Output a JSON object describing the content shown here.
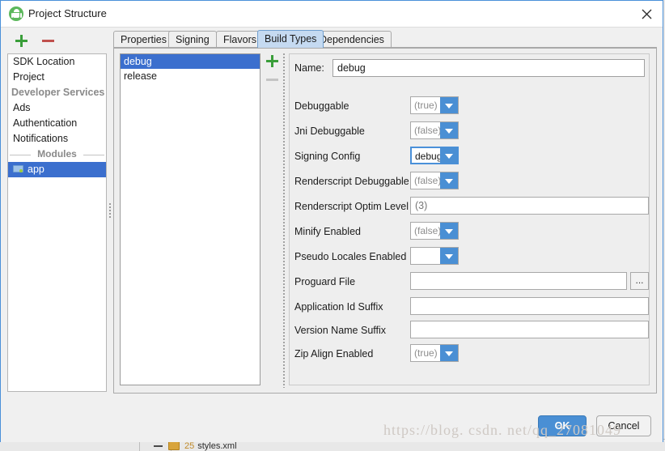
{
  "window": {
    "title": "Project Structure",
    "icon": "android-studio-icon",
    "close_label": "✕"
  },
  "sidebar": {
    "add_label": "+",
    "remove_label": "−",
    "items": [
      {
        "label": "SDK Location",
        "type": "item",
        "selected": false
      },
      {
        "label": "Project",
        "type": "item",
        "selected": false
      },
      {
        "label": "Developer Services",
        "type": "group",
        "selected": false
      },
      {
        "label": "Ads",
        "type": "item",
        "selected": false
      },
      {
        "label": "Authentication",
        "type": "item",
        "selected": false
      },
      {
        "label": "Notifications",
        "type": "item",
        "selected": false
      },
      {
        "label": "Modules",
        "type": "separator",
        "selected": false
      },
      {
        "label": "app",
        "type": "module",
        "selected": true
      }
    ]
  },
  "tabs": [
    {
      "label": "Properties",
      "active": false
    },
    {
      "label": "Signing",
      "active": false
    },
    {
      "label": "Flavors",
      "active": false
    },
    {
      "label": "Build Types",
      "active": true
    },
    {
      "label": "Dependencies",
      "active": false
    }
  ],
  "build_types": {
    "add_label": "+",
    "remove_label": "−",
    "items": [
      {
        "label": "debug",
        "selected": true
      },
      {
        "label": "release",
        "selected": false
      }
    ]
  },
  "form": {
    "name_label": "Name:",
    "name_value": "debug",
    "fields": [
      {
        "label": "Debuggable",
        "kind": "combo",
        "value": "(true)",
        "placeholder": true,
        "focused": false
      },
      {
        "label": "Jni Debuggable",
        "kind": "combo",
        "value": "(false)",
        "placeholder": true,
        "focused": false
      },
      {
        "label": "Signing Config",
        "kind": "combo",
        "value": "debug",
        "placeholder": false,
        "focused": true
      },
      {
        "label": "Renderscript Debuggable",
        "kind": "combo",
        "value": "(false)",
        "placeholder": true,
        "focused": false
      },
      {
        "label": "Renderscript Optim Level",
        "kind": "text",
        "value": "(3)",
        "placeholder": true,
        "focused": false
      },
      {
        "label": "Minify Enabled",
        "kind": "combo",
        "value": "(false)",
        "placeholder": true,
        "focused": false
      },
      {
        "label": "Pseudo Locales Enabled",
        "kind": "combo",
        "value": "",
        "placeholder": true,
        "focused": false
      },
      {
        "label": "Proguard File",
        "kind": "text-browse",
        "value": "",
        "placeholder": false,
        "focused": false,
        "browse_label": "..."
      },
      {
        "label": "Application Id Suffix",
        "kind": "text",
        "value": "",
        "placeholder": false,
        "focused": false
      },
      {
        "label": "Version Name Suffix",
        "kind": "text",
        "value": "",
        "placeholder": false,
        "focused": false
      },
      {
        "label": "Zip Align Enabled",
        "kind": "combo",
        "value": "(true)",
        "placeholder": true,
        "focused": false
      }
    ]
  },
  "footer": {
    "ok_label": "OK",
    "cancel_label": "Cancel"
  },
  "watermark": "https://blog. csdn. net/qq_27081049",
  "background": {
    "file_number": "25",
    "file_name": "styles.xml"
  },
  "colors": {
    "accent_blue": "#4a8fd4",
    "selection_blue": "#3b6fce",
    "tab_active": "#c5daf1",
    "add_green": "#3a9e3a",
    "remove_red": "#c0504d",
    "dialog_bg": "#f0f0f0"
  }
}
